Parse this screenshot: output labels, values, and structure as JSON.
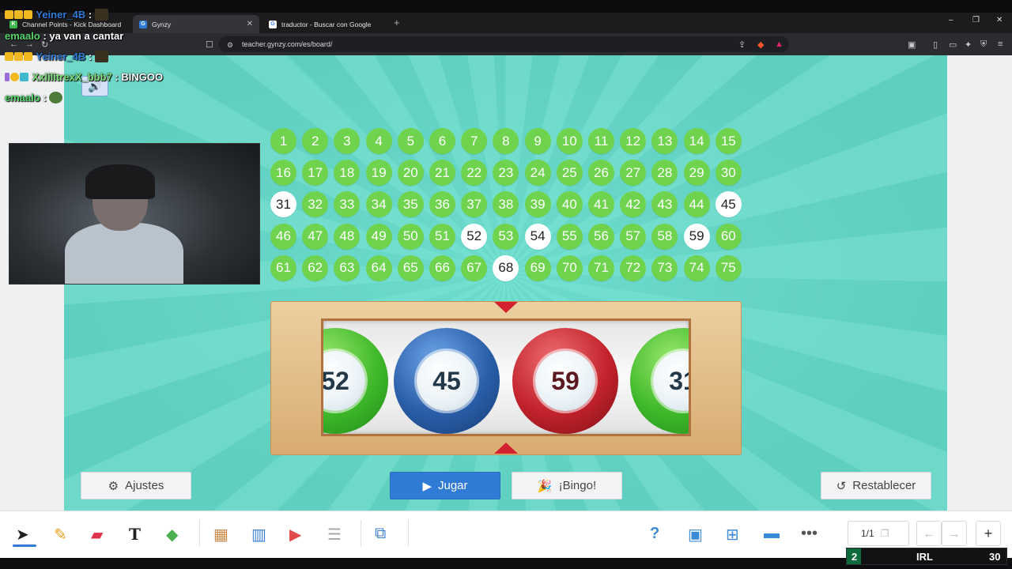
{
  "browser": {
    "tabs": [
      {
        "label": "Channel Points - Kick Dashboard",
        "active": false
      },
      {
        "label": "Gynzy",
        "active": true
      },
      {
        "label": "traductor - Buscar con Google",
        "active": false
      }
    ],
    "url": "teacher.gynzy.com/es/board/"
  },
  "board": {
    "numbers": [
      "1",
      "2",
      "3",
      "4",
      "5",
      "6",
      "7",
      "8",
      "9",
      "10",
      "11",
      "12",
      "13",
      "14",
      "15",
      "16",
      "17",
      "18",
      "19",
      "20",
      "21",
      "22",
      "23",
      "24",
      "25",
      "26",
      "27",
      "28",
      "29",
      "30",
      "31",
      "32",
      "33",
      "34",
      "35",
      "36",
      "37",
      "38",
      "39",
      "40",
      "41",
      "42",
      "43",
      "44",
      "45",
      "46",
      "47",
      "48",
      "49",
      "50",
      "51",
      "52",
      "53",
      "54",
      "55",
      "56",
      "57",
      "58",
      "59",
      "60",
      "61",
      "62",
      "63",
      "64",
      "65",
      "66",
      "67",
      "68",
      "69",
      "70",
      "71",
      "72",
      "73",
      "74",
      "75"
    ],
    "called": [
      "31",
      "45",
      "52",
      "54",
      "59",
      "68"
    ]
  },
  "drum": {
    "balls": [
      {
        "number": "52",
        "color": "green"
      },
      {
        "number": "45",
        "color": "blue"
      },
      {
        "number": "59",
        "color": "red"
      },
      {
        "number": "31",
        "color": "green"
      }
    ]
  },
  "buttons": {
    "settings": "Ajustes",
    "play": "Jugar",
    "bingo": "¡Bingo!",
    "reset": "Restablecer"
  },
  "toolbar": {
    "page_indicator": "1/1"
  },
  "stream": {
    "chat": [
      {
        "user": "Yeiner_4B",
        "text": ":",
        "user_color": "#2f7bd6"
      },
      {
        "user": "emaalo",
        "text": ": ya van a cantar",
        "user_color": "#55d66b"
      },
      {
        "user": "Yeiner_4B",
        "text": ":",
        "user_color": "#2f7bd6"
      },
      {
        "user": "XxlilitrexX_bbb7",
        "text": ": BINGOO",
        "user_color": "#7ee07a"
      },
      {
        "user": "emaalo",
        "text": ":",
        "user_color": "#55d66b"
      }
    ],
    "irl_left": "2",
    "irl_label": "IRL",
    "irl_right": "30"
  },
  "colors": {
    "number_bg": "#6fd34d",
    "called_bg": "#ffffff",
    "play_button": "#2f7bd6",
    "marker": "#d4212f"
  }
}
